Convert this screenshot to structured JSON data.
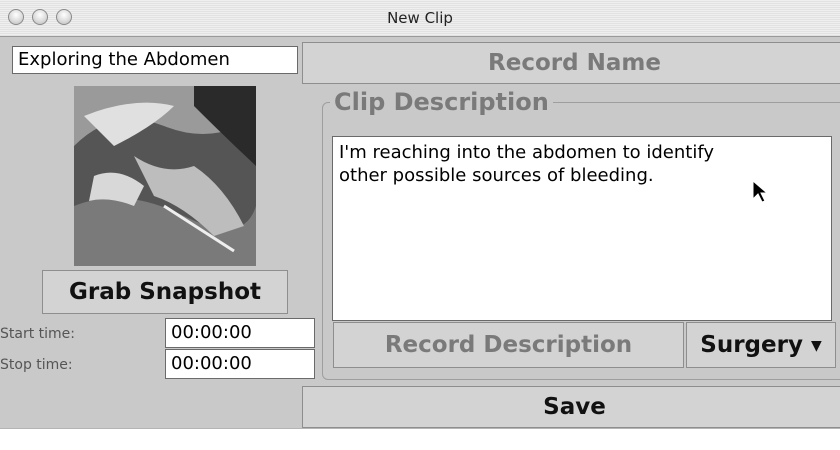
{
  "window": {
    "title": "New Clip"
  },
  "left_panel": {
    "title_field_value": "Exploring the Abdomen",
    "grab_snapshot_label": "Grab Snapshot",
    "start_time_label": "Start time:",
    "start_time_value": "00:00:00",
    "stop_time_label": "Stop time:",
    "stop_time_value": "00:00:00"
  },
  "right_panel": {
    "record_name_label": "Record Name",
    "clip_description_title": "Clip Description",
    "description_text": "I'm reaching into the abdomen to identify\nother possible sources of bleeding.",
    "record_description_label": "Record Description",
    "category_selected": "Surgery"
  },
  "footer": {
    "save_label": "Save"
  },
  "icons": {
    "window_buttons": [
      "close-icon",
      "minimize-icon",
      "zoom-icon"
    ],
    "dropdown": "chevron-down-icon",
    "pointer": "mouse-pointer-icon"
  }
}
